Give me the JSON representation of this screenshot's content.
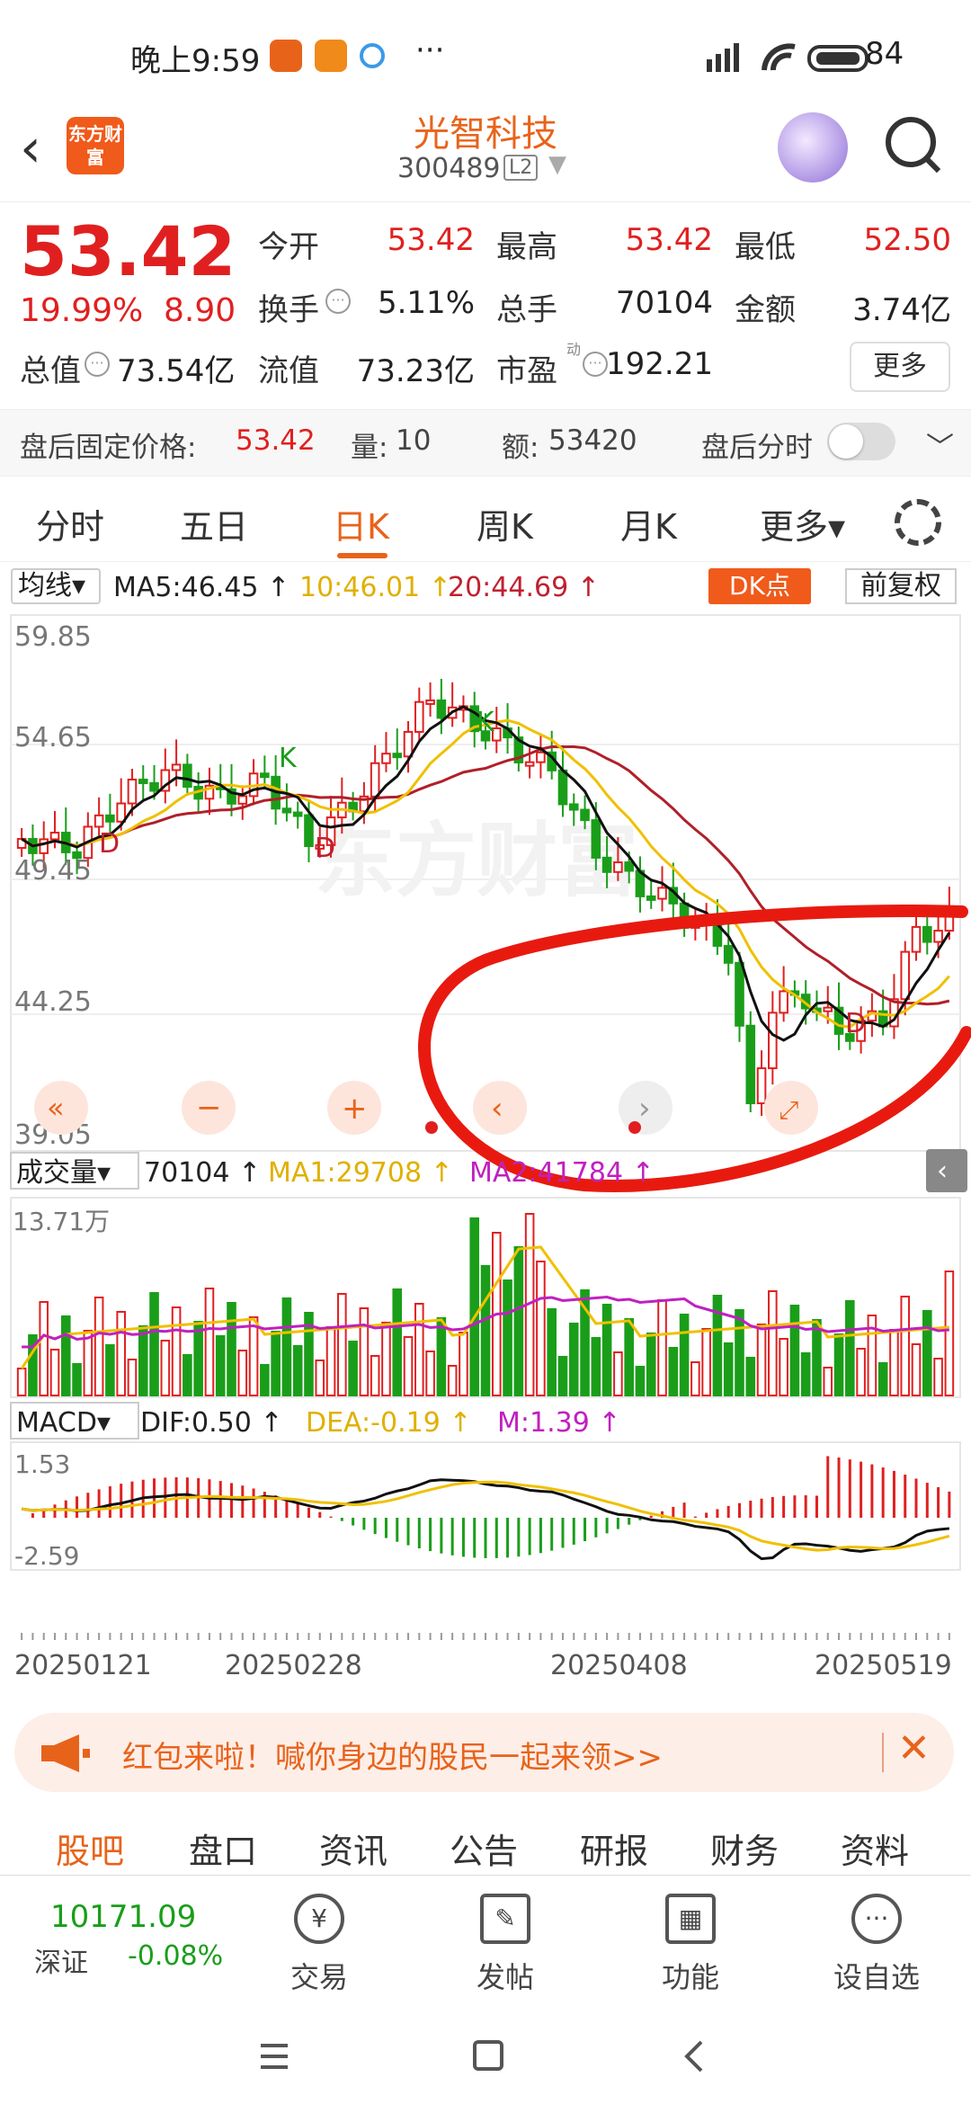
{
  "status_bar": {
    "time": "晚上9:59",
    "more": "···",
    "battery": "84"
  },
  "header": {
    "stock_name": "光智科技",
    "stock_code": "300489",
    "level": "L2",
    "logo_text": "东方财富"
  },
  "quote": {
    "price": "53.42",
    "change_pct": "19.99%",
    "change_amt": "8.90",
    "open_label": "今开",
    "open": "53.42",
    "high_label": "最高",
    "high": "53.42",
    "low_label": "最低",
    "low": "52.50",
    "turnover_label": "换手",
    "turnover": "5.11%",
    "volume_label": "总手",
    "volume": "70104",
    "amount_label": "金额",
    "amount": "3.74亿",
    "mktcap_label": "总值",
    "mktcap": "73.54亿",
    "float_label": "流值",
    "float": "73.23亿",
    "pe_label": "市盈",
    "pe": "192.21",
    "more_button": "更多"
  },
  "after_hours": {
    "label": "盘后固定价格:",
    "price": "53.42",
    "qty_label": "量:",
    "qty": "10",
    "amt_label": "额:",
    "amt": "53420",
    "timeshare_label": "盘后分时"
  },
  "tabs": [
    "分时",
    "五日",
    "日K",
    "周K",
    "月K",
    "更多▾"
  ],
  "chart_header": {
    "ma_select": "均线▾",
    "ma5": "MA5:46.45 ↑",
    "ma10": "10:46.01 ↑",
    "ma20": "20:44.69 ↑",
    "dk_button": "DK点",
    "adjust_button": "前复权"
  },
  "kline": {
    "y_labels": [
      "59.85",
      "54.65",
      "49.45",
      "44.25",
      "39.05"
    ],
    "k_label": "K",
    "d_label": "D"
  },
  "volume_header": {
    "select": "成交量▾",
    "value": "70104 ↑",
    "ma1": "MA1:29708 ↑",
    "ma2": "MA2:41784 ↑",
    "max_label": "13.71万"
  },
  "macd_header": {
    "select": "MACD▾",
    "dif": "DIF:0.50 ↑",
    "dea": "DEA:-0.19 ↑",
    "m": "M:1.39 ↑",
    "top_label": "1.53",
    "bottom_label": "-2.59"
  },
  "dates": [
    "20250121",
    "20250228",
    "20250408",
    "20250519"
  ],
  "colors": {
    "up": "#e02020",
    "down": "#1a9e1a",
    "accent": "#e8631a",
    "ma5": "#111111",
    "ma10": "#f0c000",
    "ma20": "#b0202a",
    "annotation": "#e81a10"
  },
  "chart_data": {
    "type": "candlestick",
    "ylim": [
      39.05,
      59.85
    ],
    "ma5_last": 46.45,
    "ma10_last": 46.01,
    "ma20_last": 44.69,
    "volume_max": 137100,
    "last_volume": 70104,
    "macd": {
      "dif": 0.5,
      "dea": -0.19,
      "m": 1.39,
      "ylim": [
        -2.59,
        1.53
      ]
    }
  },
  "banner": {
    "text": "红包来啦！喊你身边的股民一起来领>>",
    "close": "✕"
  },
  "sub_tabs": [
    "股吧",
    "盘口",
    "资讯",
    "公告",
    "研报",
    "财务",
    "资料"
  ],
  "bottom_bar": {
    "index_value": "10171.09",
    "index_name": "深证",
    "index_change": "-0.08%",
    "items": [
      "交易",
      "发帖",
      "功能",
      "设自选"
    ]
  }
}
